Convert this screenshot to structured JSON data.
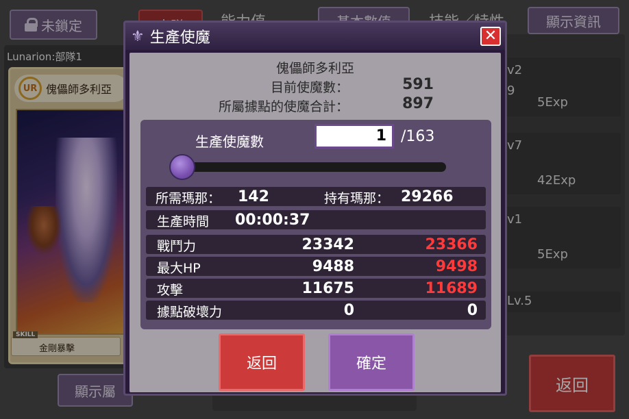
{
  "background": {
    "lock_label": "未鎖定",
    "sortie_label": "出隊",
    "ability_heading": "能力值",
    "basic_button": "基本數值",
    "skills_heading": "技能／特性",
    "info_button": "顯示資訊",
    "unit_label": "Lunarion:部隊1",
    "card": {
      "rarity": "UR",
      "name": "傀儡師多利亞",
      "skill_tag": "SKILL",
      "skill_name": "金剛暴擊"
    },
    "show_attr_button": "顯示屬",
    "skill_rows": [
      {
        "lv": "v2",
        "side": "9",
        "exp": "5Exp"
      },
      {
        "lv": "v7",
        "side": "",
        "exp": "42Exp"
      },
      {
        "lv": "v1",
        "side": "",
        "exp": "5Exp"
      },
      {
        "lv": "Lv.5",
        "side": "",
        "exp": ""
      }
    ],
    "back_button": "返回"
  },
  "modal": {
    "title": "生產使魔",
    "title_icon": "fleur-de-lis-icon",
    "close_icon": "close-icon",
    "unit_name": "傀儡師多利亞",
    "current_familiars_label": "目前使魔數：",
    "current_familiars_value": "591",
    "base_total_label": "所屬據點的使魔合計：",
    "base_total_value": "897",
    "produce_count_label": "生產使魔數",
    "produce_count_value": "1",
    "produce_count_max": "/163",
    "slider_value": 1,
    "slider_max": 163,
    "mana_required_label": "所需瑪那：",
    "mana_required_value": "142",
    "mana_owned_label": "持有瑪那：",
    "mana_owned_value": "29266",
    "time_label": "生產時間",
    "time_value": "00:00:37",
    "stats": [
      {
        "label": "戰鬥力",
        "current": "23342",
        "after": "23366"
      },
      {
        "label": "最大HP",
        "current": "9488",
        "after": "9498"
      },
      {
        "label": "攻擊",
        "current": "11675",
        "after": "11689"
      },
      {
        "label": "據點破壞力",
        "current": "0",
        "after": "0"
      }
    ],
    "cancel_label": "返回",
    "confirm_label": "確定"
  },
  "colors": {
    "accent_purple": "#8a56a8",
    "cancel_red": "#cc3a3a",
    "increase_red": "#ff3a3a"
  }
}
